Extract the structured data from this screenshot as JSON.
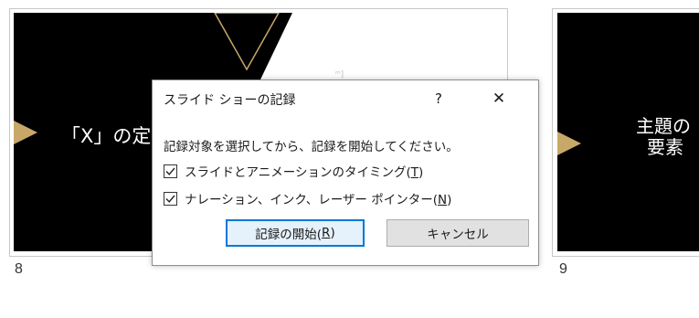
{
  "slides": [
    {
      "title": "「X」の定量",
      "number": "8"
    },
    {
      "title_line1": "主題の",
      "title_line2": "要素",
      "number": "9"
    }
  ],
  "dialog": {
    "title": "スライド ショーの記録",
    "help_label": "?",
    "close_label": "✕",
    "message": "記録対象を選択してから、記録を開始してください。",
    "options": [
      {
        "label": "スライドとアニメーションのタイミング(",
        "key": "T",
        "suffix": ")",
        "checked": true
      },
      {
        "label": "ナレーション、インク、レーザー ポインター(",
        "key": "N",
        "suffix": ")",
        "checked": true
      }
    ],
    "start_button": {
      "label": "記録の開始(",
      "key": "R",
      "suffix": ")"
    },
    "cancel_button": "キャンセル"
  },
  "colors": {
    "accent": "#c8a869",
    "focus": "#0078d7"
  }
}
